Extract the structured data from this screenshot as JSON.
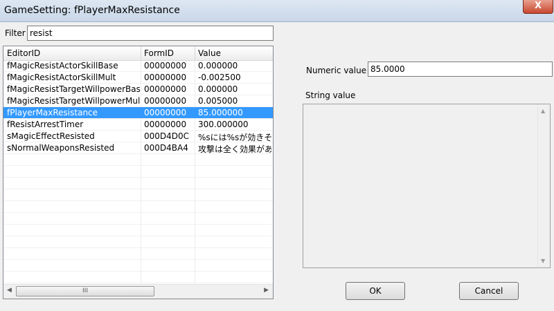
{
  "window": {
    "title": "GameSetting: fPlayerMaxResistance",
    "close_glyph": "X"
  },
  "filter": {
    "label": "Filter",
    "value": "resist"
  },
  "list": {
    "columns": [
      "EditorID",
      "FormID",
      "Value"
    ],
    "rows": [
      {
        "editor_id": "fMagicResistActorSkillBase",
        "form_id": "00000000",
        "value": "0.000000"
      },
      {
        "editor_id": "fMagicResistActorSkillMult",
        "form_id": "00000000",
        "value": "-0.002500"
      },
      {
        "editor_id": "fMagicResistTargetWillpowerBase",
        "form_id": "00000000",
        "value": "0.000000"
      },
      {
        "editor_id": "fMagicResistTargetWillpowerMult",
        "form_id": "00000000",
        "value": "0.005000"
      },
      {
        "editor_id": "fPlayerMaxResistance",
        "form_id": "00000000",
        "value": "85.000000"
      },
      {
        "editor_id": "fResistArrestTimer",
        "form_id": "00000000",
        "value": "300.000000"
      },
      {
        "editor_id": "sMagicEffectResisted",
        "form_id": "000D4D0C",
        "value": "%sには%sが効きそうにな"
      },
      {
        "editor_id": "sNormalWeaponsResisted",
        "form_id": "000D4BA4",
        "value": "攻撃は全く効果がありま"
      }
    ],
    "selected_index": 4,
    "scroll_thumb": "III"
  },
  "numeric": {
    "label": "Numeric value",
    "value": "85.0000"
  },
  "string": {
    "label": "String value",
    "value": ""
  },
  "buttons": {
    "ok": "OK",
    "cancel": "Cancel"
  },
  "colors": {
    "selection": "#3399ff",
    "titlebar": "#c9d7e8",
    "close": "#c7472e"
  }
}
